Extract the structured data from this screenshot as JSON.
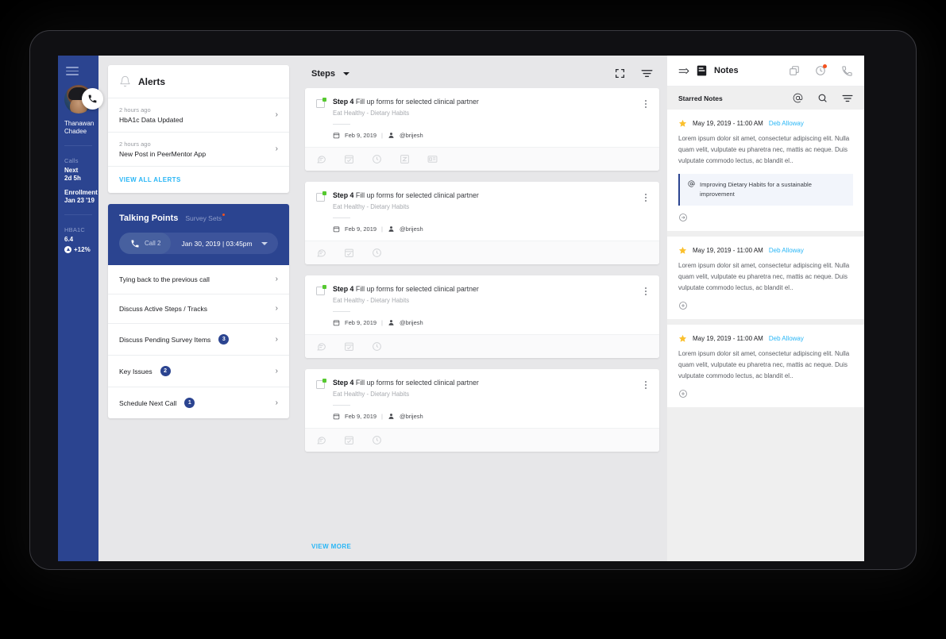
{
  "sidebar": {
    "menu_icon": "hamburger-icon",
    "avatar_icon": "user-avatar",
    "call_icon": "phone-icon",
    "user_name_line1": "Thanawan",
    "user_name_line2": "Chadee",
    "calls_label": "Calls",
    "next_label": "Next",
    "next_value": "2d 5h",
    "enrollment_label": "Enrollment",
    "enrollment_value": "Jan 23 '19",
    "hba1c_label": "HBA1C",
    "hba1c_value": "6.4",
    "hba1c_delta": "+12%",
    "accent": "#2b4490"
  },
  "alerts": {
    "icon": "alert-bell-icon",
    "title": "Alerts",
    "items": [
      {
        "ago": "2 hours ago",
        "text": "HbA1c Data Updated"
      },
      {
        "ago": "2 hours ago",
        "text": "New Post in PeerMentor App"
      }
    ],
    "view_all_label": "VIEW ALL ALERTS",
    "link_color": "#29b6f6"
  },
  "talking_points": {
    "title": "Talking Points",
    "subtitle": "Survey Sets",
    "call_label": "Call 2",
    "call_icon": "phone-icon",
    "date_value": "Jan 30, 2019 |  03:45pm",
    "rows": [
      {
        "label": "Tying back to the previous call",
        "badge": ""
      },
      {
        "label": "Discuss Active Steps / Tracks",
        "badge": ""
      },
      {
        "label": "Discuss Pending Survey Items",
        "badge": "3"
      },
      {
        "label": "Key Issues",
        "badge": "2"
      },
      {
        "label": "Schedule Next Call",
        "badge": "1"
      }
    ]
  },
  "steps": {
    "header_label": "Steps",
    "expand_icon": "fullscreen-icon",
    "filter_icon": "filter-icon",
    "view_more_label": "VIEW MORE",
    "cards": [
      {
        "step_label": "Step 4",
        "title": "Fill up forms for selected clinical partner",
        "tags": "Eat Healthy  -  Dietary Habits",
        "date": "Feb 9, 2019",
        "assignee": "@brijesh",
        "footer_icons": [
          "comment-icon",
          "calendar-check-icon",
          "clock-icon",
          "attachment-icon",
          "note-icon"
        ]
      },
      {
        "step_label": "Step 4",
        "title": "Fill up forms for selected clinical partner",
        "tags": "Eat Healthy  -  Dietary Habits",
        "date": "Feb 9, 2019",
        "assignee": "@brijesh",
        "footer_icons": [
          "comment-icon",
          "calendar-check-icon",
          "clock-icon"
        ]
      },
      {
        "step_label": "Step 4",
        "title": "Fill up forms for selected clinical partner",
        "tags": "Eat Healthy  -  Dietary Habits",
        "date": "Feb 9, 2019",
        "assignee": "@brijesh",
        "footer_icons": [
          "comment-icon",
          "calendar-check-icon",
          "clock-icon"
        ]
      },
      {
        "step_label": "Step 4",
        "title": "Fill up forms for selected clinical partner",
        "tags": "Eat Healthy  -  Dietary Habits",
        "date": "Feb 9, 2019",
        "assignee": "@brijesh",
        "footer_icons": [
          "comment-icon",
          "calendar-check-icon",
          "clock-icon"
        ]
      }
    ]
  },
  "notes": {
    "collapse_icon": "collapse-arrow-icon",
    "notes_icon": "notes-icon",
    "title": "Notes",
    "header_icons": [
      "copy-icon",
      "history-clock-icon",
      "phone-icon"
    ],
    "starred_label": "Starred Notes",
    "starred_icons": [
      "mention-icon",
      "search-icon",
      "filter-icon"
    ],
    "items": [
      {
        "star_icon": "star-icon",
        "date": "May 19, 2019",
        "separator": "-",
        "time": "11:00 AM",
        "author": "Deb Alloway",
        "body": "Lorem ipsum dolor sit amet, consectetur adipiscing elit. Nulla quam velit, vulputate eu pharetra nec, mattis ac neque. Duis vulputate commodo lectus, ac blandit el..",
        "quote": "Improving Dietary Habits for a sustainable improvement",
        "quote_icon": "mention-icon",
        "action_icon": "reply-icon"
      },
      {
        "star_icon": "star-icon",
        "date": "May 19, 2019",
        "separator": "-",
        "time": "11:00 AM",
        "author": "Deb Alloway",
        "body": "Lorem ipsum dolor sit amet, consectetur adipiscing elit. Nulla quam velit, vulputate eu pharetra nec, mattis ac neque. Duis vulputate commodo lectus, ac blandit el..",
        "quote": "",
        "quote_icon": "",
        "action_icon": "add-circle-icon"
      },
      {
        "star_icon": "star-icon",
        "date": "May 19, 2019",
        "separator": "-",
        "time": "11:00 AM",
        "author": "Deb Alloway",
        "body": "Lorem ipsum dolor sit amet, consectetur adipiscing elit. Nulla quam velit, vulputate eu pharetra nec, mattis ac neque. Duis vulputate commodo lectus, ac blandit el..",
        "quote": "",
        "quote_icon": "",
        "action_icon": "add-circle-icon"
      }
    ]
  }
}
